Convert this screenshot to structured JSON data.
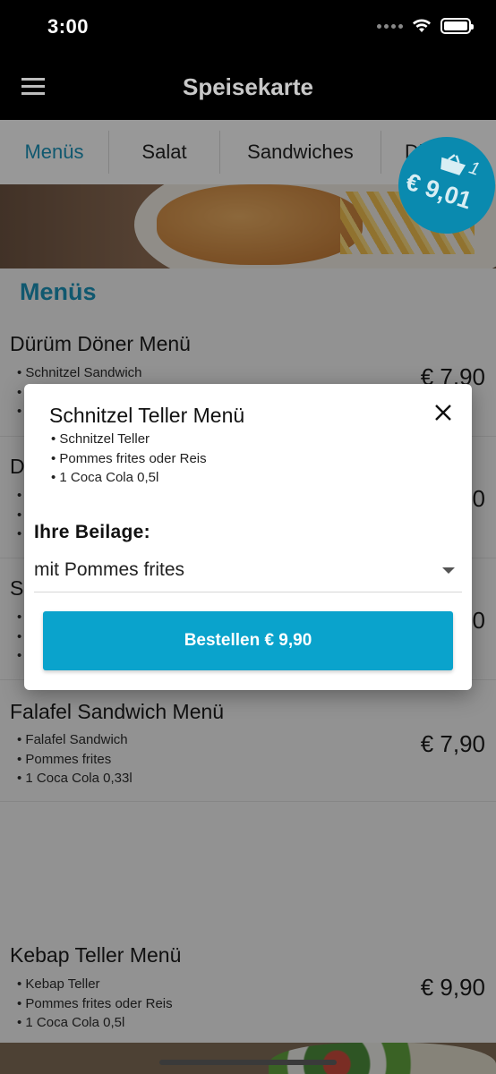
{
  "status_bar": {
    "time": "3:00"
  },
  "app_bar": {
    "title": "Speisekarte"
  },
  "tabs": [
    {
      "label": "Menüs",
      "active": true
    },
    {
      "label": "Salat"
    },
    {
      "label": "Sandwiches"
    },
    {
      "label": "Di…"
    }
  ],
  "cart": {
    "count": "1",
    "total": "€ 9,01"
  },
  "section": {
    "title": "Menüs"
  },
  "menu_items": [
    {
      "name": "Dürüm Döner Menü",
      "lines": [
        "Schnitzel Sandwich",
        "",
        ""
      ],
      "price": "€ 7,90"
    },
    {
      "name": "D",
      "lines": [
        "",
        "",
        ""
      ],
      "price": "0"
    },
    {
      "name": "S",
      "lines": [
        "",
        "",
        ""
      ],
      "price": "0"
    },
    {
      "name": "Falafel Sandwich Menü",
      "lines": [
        "Falafel Sandwich",
        "Pommes frites",
        "1 Coca Cola 0,33l"
      ],
      "price": "€ 7,90"
    },
    {
      "name": "Kebap Teller Menü",
      "lines": [
        "Kebap Teller",
        "Pommes frites oder Reis",
        "1 Coca Cola 0,5l"
      ],
      "price": "€ 9,90"
    }
  ],
  "dialog": {
    "title": "Schnitzel Teller Menü",
    "lines": [
      "Schnitzel Teller",
      "Pommes frites oder Reis",
      "1 Coca Cola 0,5l"
    ],
    "side_label": "Ihre Beilage:",
    "side_value": "mit Pommes frites",
    "order_button": "Bestellen € 9,90"
  },
  "colors": {
    "accent": "#1a8fb4",
    "button": "#0aa3cc",
    "badge": "#0a8aaf"
  }
}
